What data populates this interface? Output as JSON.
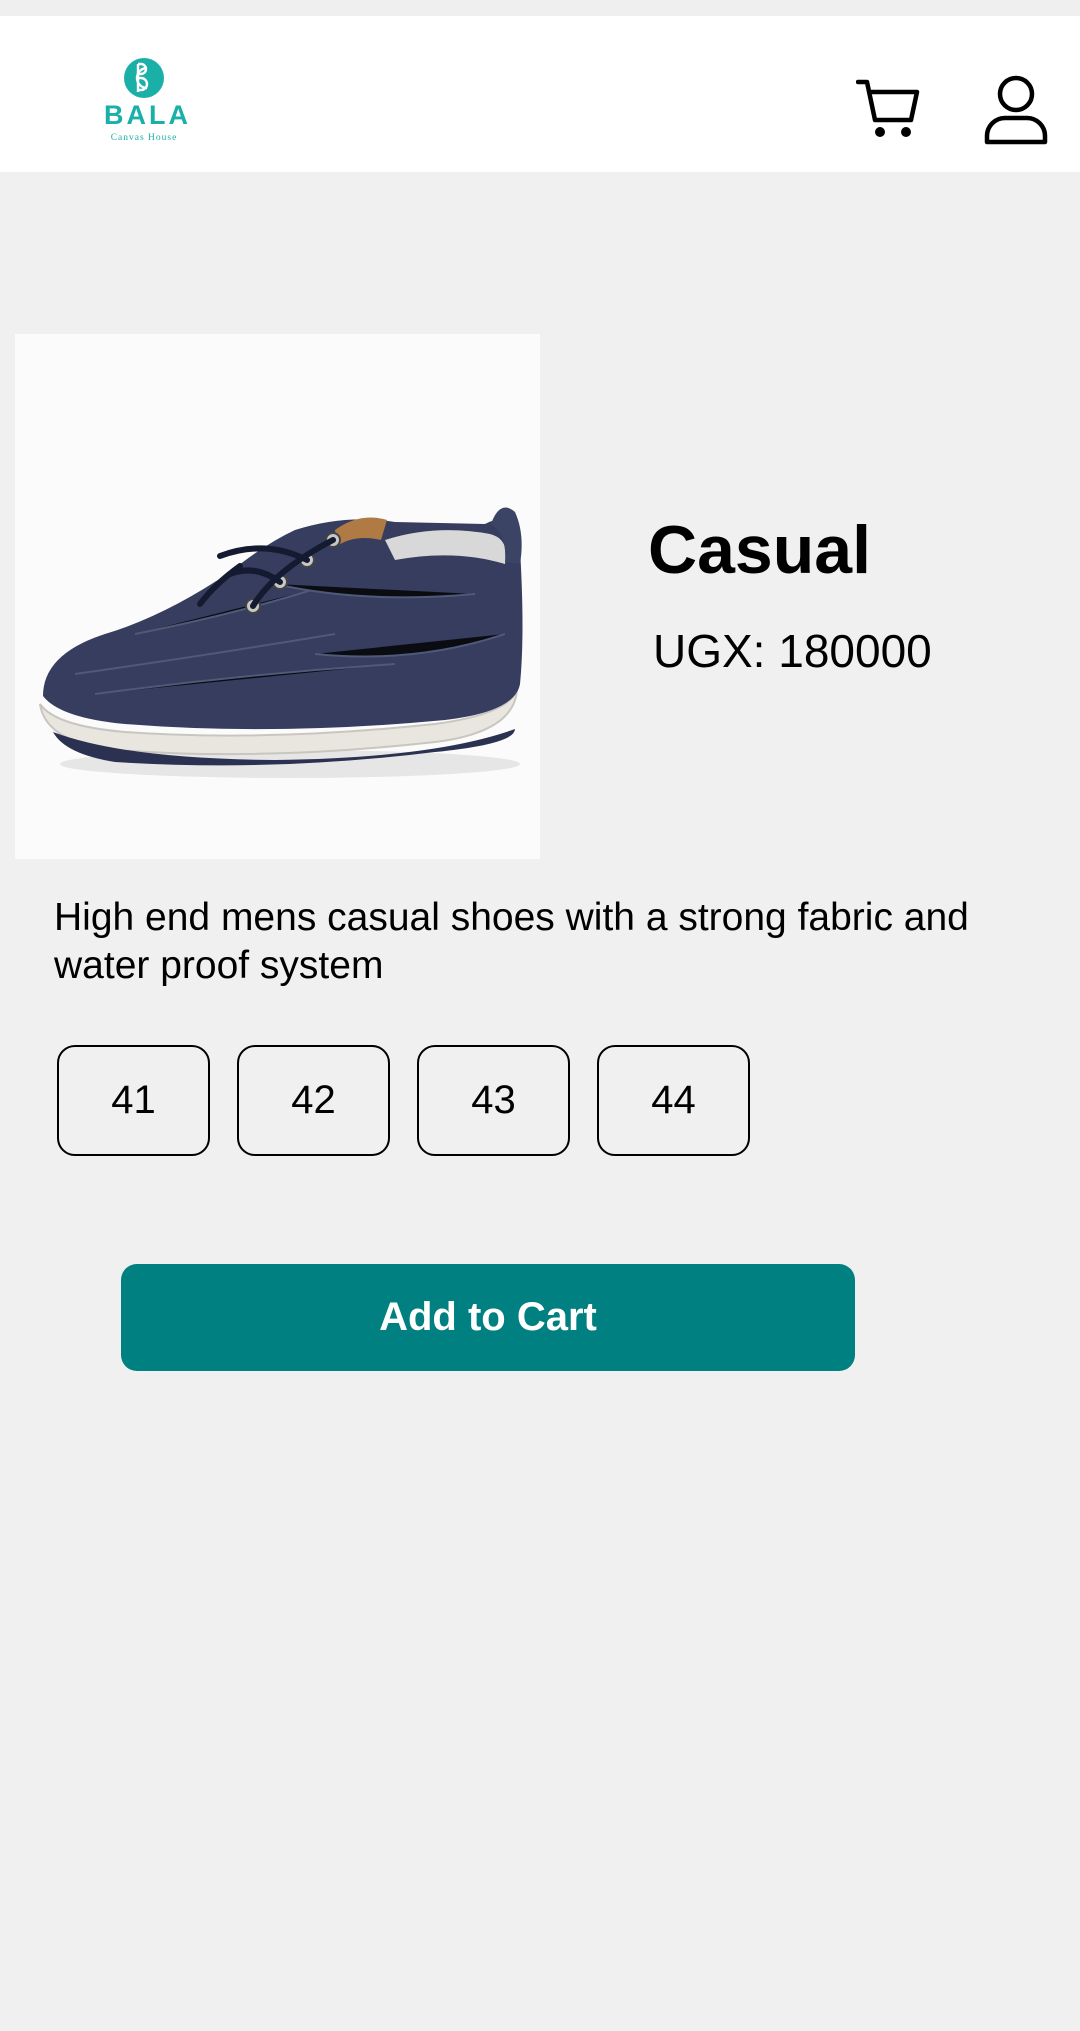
{
  "header": {
    "logo": {
      "monogram": "BCH",
      "word": "BALA",
      "subtitle": "Canvas House",
      "color": "#1ab0a8"
    },
    "icons": {
      "cart": "shopping-cart-icon",
      "profile": "user-profile-icon"
    }
  },
  "product": {
    "image_icon": "shoe-image",
    "name": "Casual",
    "price": "UGX: 180000",
    "description": "High end mens casual shoes with a strong fabric and water proof system",
    "sizes": [
      "41",
      "42",
      "43",
      "44"
    ]
  },
  "actions": {
    "add_to_cart_label": "Add to Cart",
    "accent_color": "#008080"
  }
}
